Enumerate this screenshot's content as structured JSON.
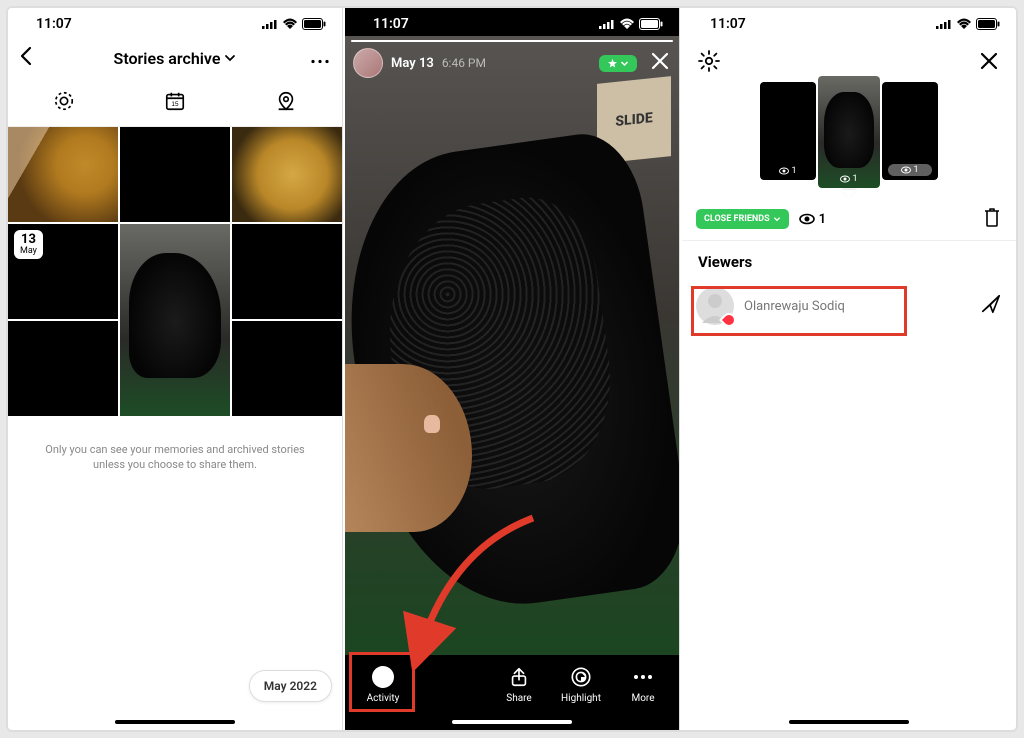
{
  "statusbar": {
    "time": "11:07"
  },
  "screen1": {
    "title": "Stories archive",
    "note": "Only you can see your memories and archived stories unless you choose to share them.",
    "month_pill": "May 2022",
    "date_badge_day": "13",
    "date_badge_month": "May"
  },
  "screen2": {
    "date": "May 13",
    "time": "6:46 PM",
    "slide_text": "SLIDE",
    "actions": {
      "activity": "Activity",
      "share": "Share",
      "highlight": "Highlight",
      "more": "More"
    }
  },
  "screen3": {
    "close_friends_label": "CLOSE FRIENDS",
    "view_count": "1",
    "thumb_view_1": "1",
    "thumb_view_2": "1",
    "thumb_view_3": "1",
    "viewers_heading": "Viewers",
    "viewer_name": "Olanrewaju Sodiq"
  }
}
